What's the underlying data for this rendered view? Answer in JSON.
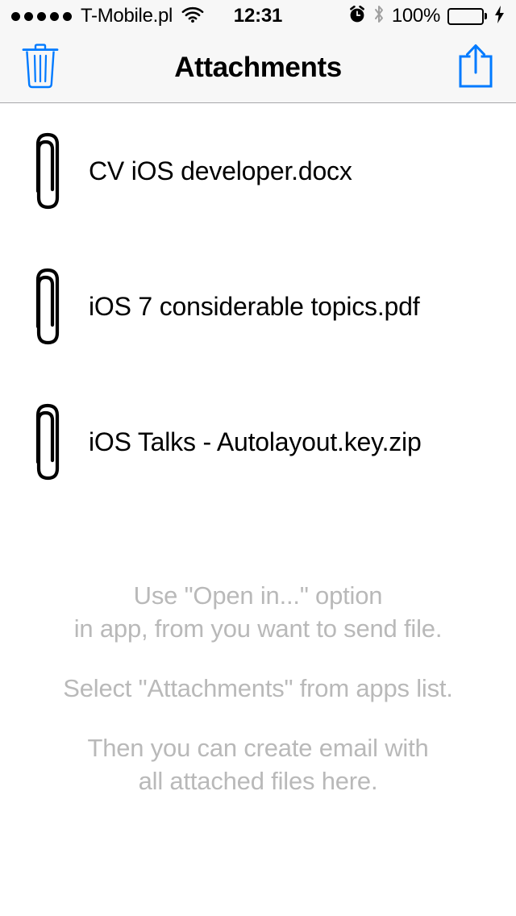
{
  "status_bar": {
    "signal_dots_filled": 5,
    "carrier": "T-Mobile.pl",
    "wifi_icon": "wifi-icon",
    "time": "12:31",
    "alarm_icon": "alarm-clock-icon",
    "bluetooth_icon": "bluetooth-icon",
    "battery_percent": "100%",
    "battery_level": 100,
    "battery_charging": true,
    "charging_icon": "lightning-bolt-icon",
    "battery_color": "#4cd764"
  },
  "nav_bar": {
    "title": "Attachments",
    "left_button": {
      "icon": "trash-icon",
      "label": "Delete"
    },
    "right_button": {
      "icon": "share-icon",
      "label": "Share"
    },
    "tint_color": "#007aff",
    "background_color": "#f7f7f7"
  },
  "attachments": [
    {
      "icon": "paperclip-icon",
      "name": "CV iOS developer.docx"
    },
    {
      "icon": "paperclip-icon",
      "name": "iOS 7 considerable topics.pdf"
    },
    {
      "icon": "paperclip-icon",
      "name": "iOS Talks - Autolayout.key.zip"
    }
  ],
  "instructions": {
    "color": "#b9b9b9",
    "paragraphs": [
      {
        "lines": [
          "Use \"Open in...\" option",
          "in app, from you want to send file."
        ]
      },
      {
        "lines": [
          "Select \"Attachments\" from apps list."
        ]
      },
      {
        "lines": [
          "Then you can create email with",
          "all attached files here."
        ]
      }
    ]
  }
}
